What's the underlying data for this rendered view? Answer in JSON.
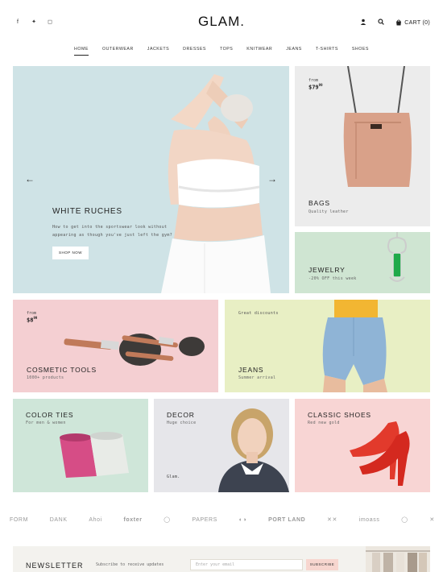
{
  "header": {
    "logo": "GLAM.",
    "social": [
      {
        "icon": "facebook-icon",
        "glyph": "f"
      },
      {
        "icon": "twitter-icon",
        "glyph": "✦"
      },
      {
        "icon": "instagram-icon",
        "glyph": "◻"
      }
    ],
    "cart_label": "CART (0)"
  },
  "nav": {
    "items": [
      "HOME",
      "OUTERWEAR",
      "JACKETS",
      "DRESSES",
      "TOPS",
      "KNITWEAR",
      "JEANS",
      "T-SHIRTS",
      "SHOES"
    ],
    "active": "HOME"
  },
  "hero": {
    "title": "WHITE RUCHES",
    "text": "How to get into the sportswear look without appearing as though you've just left the gym?",
    "button": "SHOP NOW",
    "prev_arrow": "←",
    "next_arrow": "→"
  },
  "tiles": {
    "bags": {
      "from": "from",
      "price": "$79",
      "price_cents": "99",
      "title": "BAGS",
      "sub": "Quality leather"
    },
    "jewelry": {
      "title": "JEWELRY",
      "sub": "-20% OFF this week"
    },
    "cosmetic": {
      "from": "from",
      "price": "$8",
      "price_cents": "99",
      "title": "COSMETIC TOOLS",
      "sub": "1000+ products"
    },
    "jeans": {
      "tag": "Great discounts",
      "title": "JEANS",
      "sub": "Summer arrival"
    },
    "colorties": {
      "title": "COLOR TIES",
      "sub": "For men & women"
    },
    "decor": {
      "title": "DECOR",
      "sub": "Huge choice",
      "caption": "Glam."
    },
    "shoes": {
      "title": "CLASSIC SHOES",
      "sub": "Red new gold"
    }
  },
  "brands": [
    "FORM",
    "DANK",
    "Ahoi",
    "foxter",
    "◯",
    "PAPERS",
    "◐◑",
    "PORT LAND",
    "✕✕",
    "imoass",
    "◯",
    "✕"
  ],
  "newsletter": {
    "title": "NEWSLETTER",
    "sub": "Subscribe to receive updates",
    "placeholder": "Enter your email",
    "button": "SUBSCRIBE"
  },
  "colors": {
    "hero_bg": "#cfe3e6",
    "bags_bg": "#ececec",
    "jewelry_bg": "#cfe5d2",
    "cosmetic_bg": "#f4cfd2",
    "jeans_bg": "#e8efc4",
    "colorties_bg": "#cfe6d9",
    "decor_bg": "#e6e6ea",
    "shoes_bg": "#f8d5d4"
  }
}
